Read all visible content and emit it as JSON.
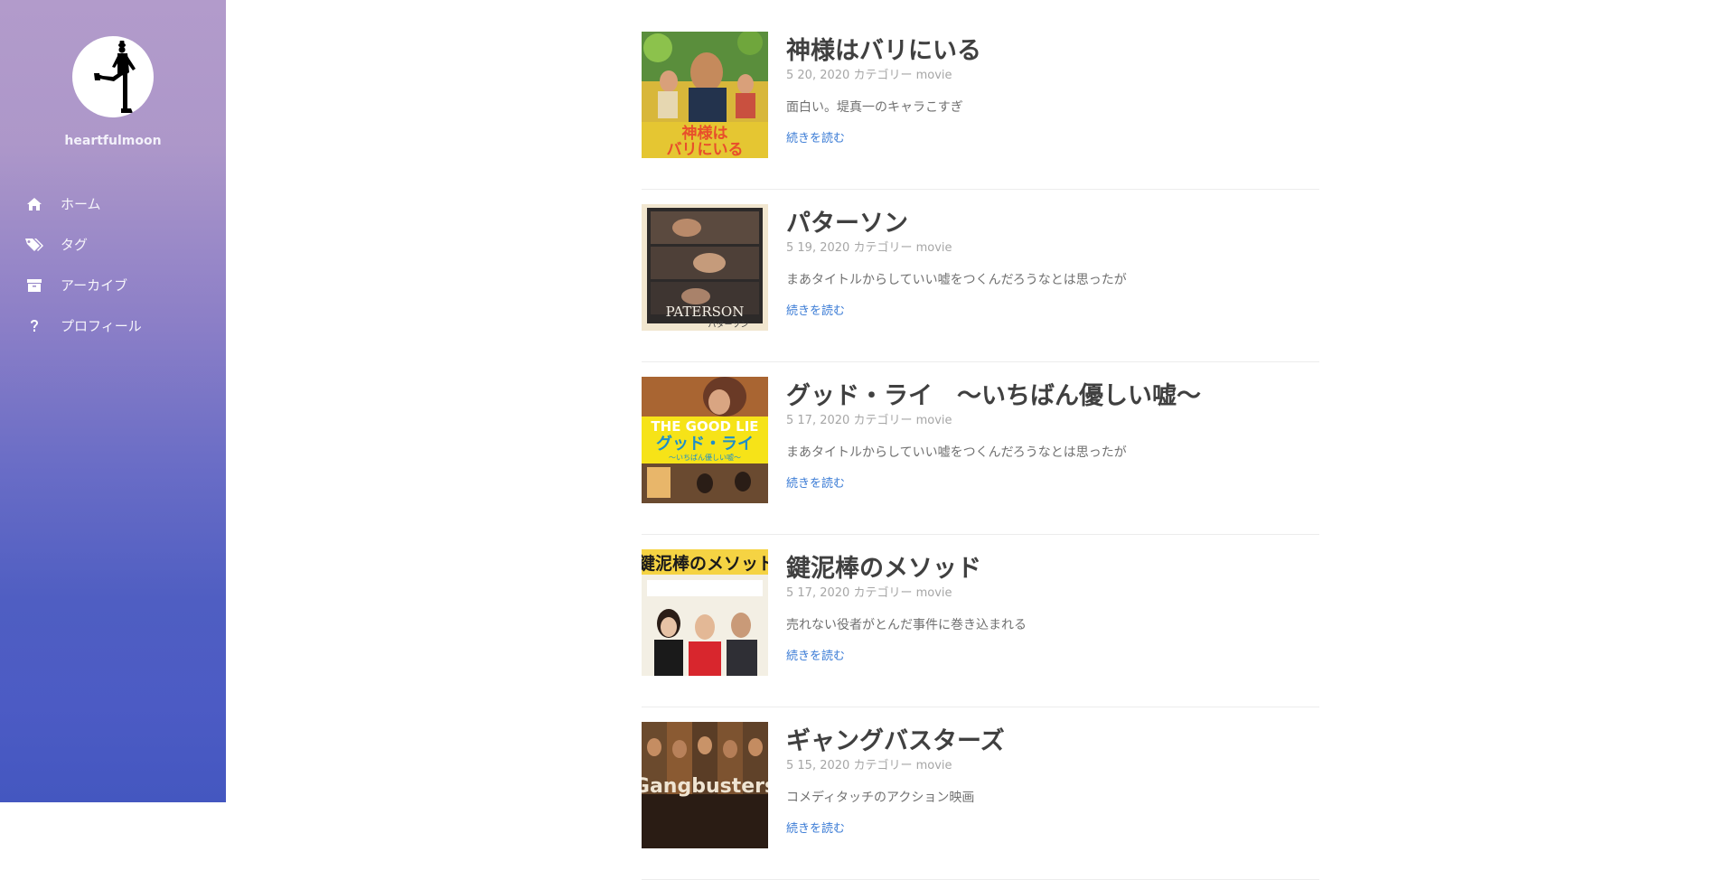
{
  "site": {
    "name": "heartfulmoon"
  },
  "nav": [
    {
      "label": "ホーム",
      "icon": "home-icon"
    },
    {
      "label": "タグ",
      "icon": "tags-icon"
    },
    {
      "label": "アーカイブ",
      "icon": "archive-icon"
    },
    {
      "label": "プロフィール",
      "icon": "question-icon"
    }
  ],
  "posts": [
    {
      "title": "神様はバリにいる",
      "date": "5 20, 2020",
      "category_label": "カテゴリー",
      "category": "movie",
      "excerpt": "面白い。堤真一のキャラこすぎ",
      "read_more": "続きを読む",
      "thumb_icon": "movie-poster-image"
    },
    {
      "title": "パターソン",
      "date": "5 19, 2020",
      "category_label": "カテゴリー",
      "category": "movie",
      "excerpt": "まあタイトルからしていい嘘をつくんだろうなとは思ったが",
      "read_more": "続きを読む",
      "thumb_icon": "movie-poster-image"
    },
    {
      "title": "グッド・ライ　〜いちばん優しい嘘〜",
      "date": "5 17, 2020",
      "category_label": "カテゴリー",
      "category": "movie",
      "excerpt": "まあタイトルからしていい嘘をつくんだろうなとは思ったが",
      "read_more": "続きを読む",
      "thumb_icon": "movie-poster-image"
    },
    {
      "title": "鍵泥棒のメソッド",
      "date": "5 17, 2020",
      "category_label": "カテゴリー",
      "category": "movie",
      "excerpt": "売れない役者がとんだ事件に巻き込まれる",
      "read_more": "続きを読む",
      "thumb_icon": "movie-poster-image"
    },
    {
      "title": "ギャングバスターズ",
      "date": "5 15, 2020",
      "category_label": "カテゴリー",
      "category": "movie",
      "excerpt": "コメディタッチのアクション映画",
      "read_more": "続きを読む",
      "thumb_icon": "movie-poster-image"
    }
  ],
  "colors": {
    "link": "#3a7bd5",
    "title": "#404040",
    "meta": "#a6a6a6",
    "sidebar_top": "#b29bcb",
    "sidebar_bottom": "#4457c0"
  }
}
